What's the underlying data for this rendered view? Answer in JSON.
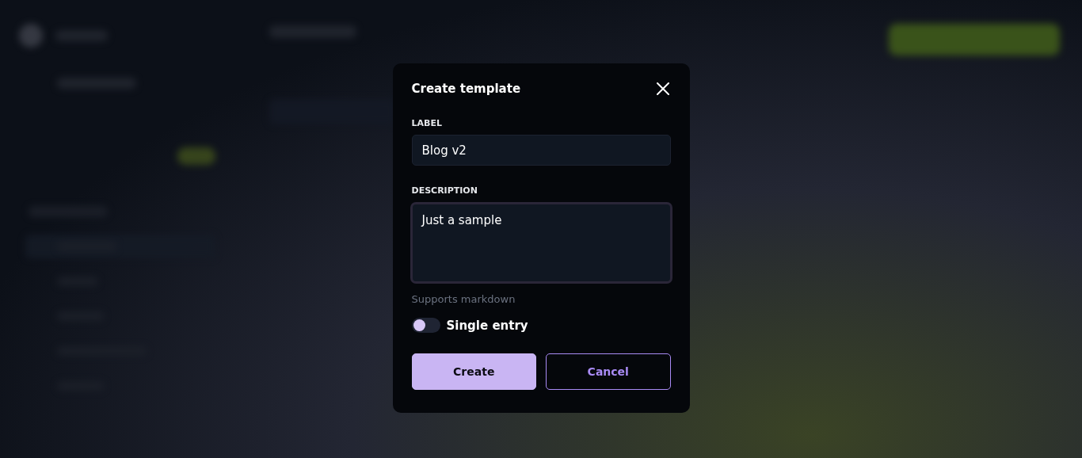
{
  "dialog": {
    "title": "Create template",
    "fields": [
      {
        "kind": "input",
        "label": "LABEL",
        "value": "Blog v2",
        "focused": false
      },
      {
        "kind": "textarea",
        "label": "DESCRIPTION",
        "value": "Just a sample",
        "focused": true,
        "hint": "Supports markdown"
      }
    ],
    "toggle": {
      "label": "Single entry",
      "on": false
    },
    "buttons": [
      {
        "kind": "primary",
        "label": "Create"
      },
      {
        "kind": "secondary",
        "label": "Cancel"
      }
    ]
  }
}
